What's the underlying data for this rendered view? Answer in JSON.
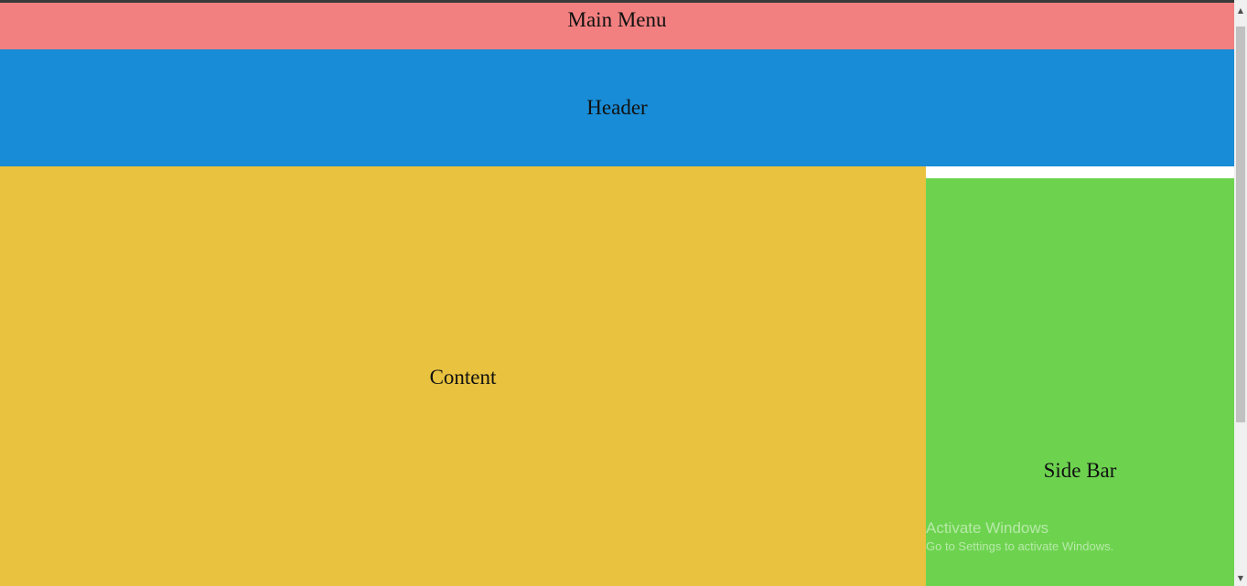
{
  "layout": {
    "main_menu_label": "Main Menu",
    "header_label": "Header",
    "content_label": "Content",
    "sidebar_label": "Side Bar"
  },
  "watermark": {
    "line1": "Activate Windows",
    "line2": "Go to Settings to activate Windows."
  },
  "scrollbar": {
    "up_icon": "arrow-up-icon",
    "down_icon": "arrow-down-icon"
  },
  "colors": {
    "main_menu": "#f28080",
    "header": "#188cd6",
    "content": "#e9c23f",
    "sidebar": "#6dd34f"
  }
}
